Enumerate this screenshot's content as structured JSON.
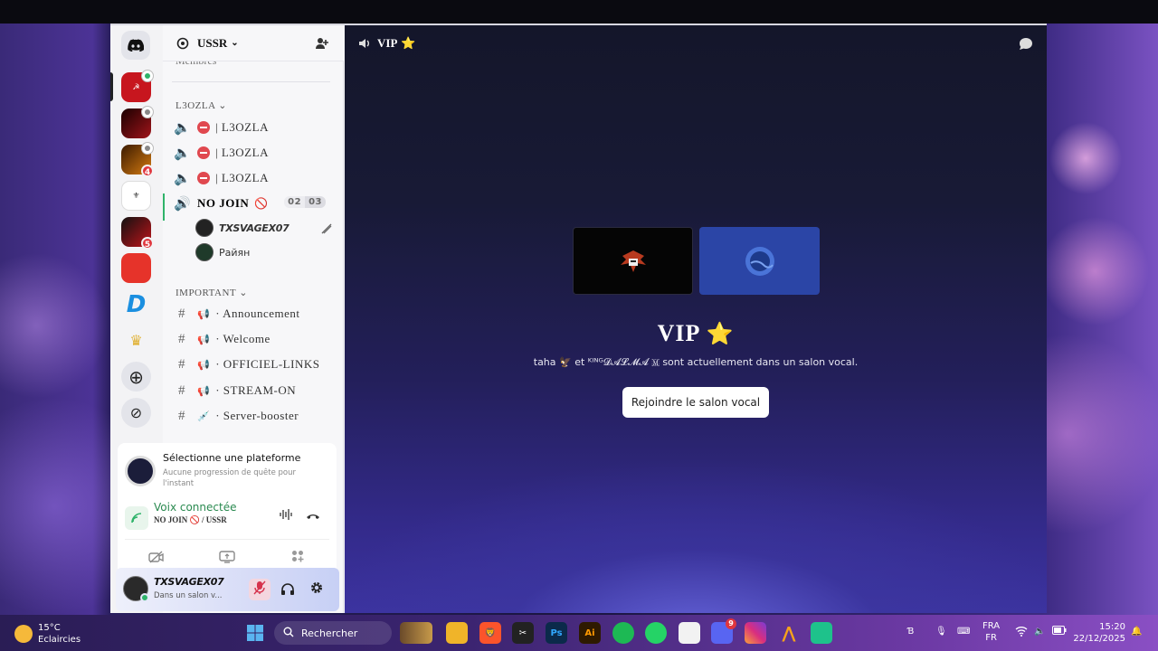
{
  "server": {
    "name": "USSR",
    "members_label": "Membres"
  },
  "categories": [
    {
      "label": "L3OZLA"
    },
    {
      "label": "IMPORTANT"
    }
  ],
  "l3ozla_channels": [
    {
      "name": "| L3OZLA"
    },
    {
      "name": "| L3OZLA"
    },
    {
      "name": "| L3OZLA"
    }
  ],
  "nojoin": {
    "name": "NO JOIN",
    "count_current": "02",
    "count_max": "03",
    "users": [
      {
        "name": "TXSVAGEX07"
      },
      {
        "name": "Райян"
      }
    ]
  },
  "important_channels": [
    {
      "name": "· Announcement",
      "emoji": "📢"
    },
    {
      "name": "· Welcome",
      "emoji": "📢"
    },
    {
      "name": "· OFFICIEL-LINKS",
      "emoji": "📢"
    },
    {
      "name": "· STREAM-ON",
      "emoji": "📢"
    },
    {
      "name": "· Server-booster",
      "emoji": "💉"
    }
  ],
  "server_badges": [
    "4",
    "5"
  ],
  "quest": {
    "title": "Sélectionne une plateforme",
    "subtitle": "Aucune progression de quête pour l'instant"
  },
  "voice": {
    "status": "Voix connectée",
    "channel": "NO JOIN 🚫 / USSR"
  },
  "user": {
    "name": "TXSVAGEX07",
    "status": "Dans un salon v..."
  },
  "main": {
    "channel_title": "VIP",
    "title": "VIP",
    "subtitle": "taha 🦅 et ᴷᴵᴺᴳ𝓓𝓐𝓛𝓜𝓐 🇲 sont actuellement dans un salon vocal.",
    "join_button": "Rejoindre le salon vocal"
  },
  "taskbar": {
    "temp": "15°C",
    "weather": "Eclaircies",
    "search": "Rechercher",
    "lang_top": "FRA",
    "lang_bottom": "FR",
    "time": "15:20",
    "date": "22/12/2025",
    "discord_badge": "9"
  },
  "colors": {
    "accent_green": "#2fb36a",
    "danger_red": "#e0484f",
    "star_gold": "#f5c542"
  }
}
